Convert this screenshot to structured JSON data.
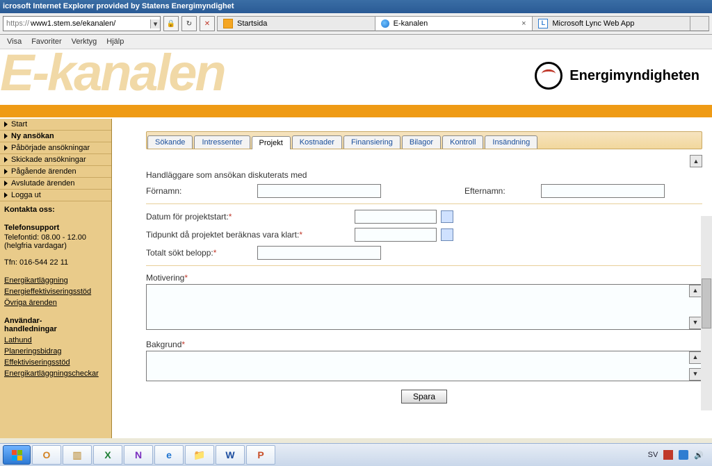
{
  "window": {
    "title": "icrosoft Internet Explorer provided by Statens Energimyndighet"
  },
  "address": {
    "protocol": "https://",
    "url": "www1.stem.se/ekanalen/"
  },
  "browser_tabs": [
    {
      "label": "Startsida",
      "icon": "fav-orange",
      "active": false
    },
    {
      "label": "E-kanalen",
      "icon": "fav-ie",
      "active": true
    },
    {
      "label": "Microsoft Lync Web App",
      "icon": "fav-lync",
      "active": false
    }
  ],
  "menubar": [
    "Visa",
    "Favoriter",
    "Verktyg",
    "Hjälp"
  ],
  "banner": {
    "logo_text": "E-kanalen",
    "brand": "Energimyndigheten"
  },
  "sidebar": {
    "nav": [
      {
        "label": "Start",
        "bold": false
      },
      {
        "label": "Ny ansökan",
        "bold": true
      },
      {
        "label": "Påbörjade ansökningar",
        "bold": false
      },
      {
        "label": "Skickade ansökningar",
        "bold": false
      },
      {
        "label": "Pågående ärenden",
        "bold": false
      },
      {
        "label": "Avslutade ärenden",
        "bold": false
      },
      {
        "label": "Logga ut",
        "bold": false
      }
    ],
    "contact_heading": "Kontakta oss:",
    "phone_heading": "Telefonsupport",
    "phone_hours": "Telefontid: 08.00 - 12.00",
    "phone_days": "(helgfria vardagar)",
    "phone_number": "Tfn: 016-544 22 11",
    "links1": [
      "Energikartläggning",
      "Energieffektiviseringsstöd",
      "Övriga ärenden"
    ],
    "guides_heading": "Användar-\nhandledningar",
    "links2": [
      "Lathund",
      "Planeringsbidrag",
      "Effektiviseringsstöd",
      "Energikartläggningscheckar"
    ]
  },
  "form_tabs": [
    "Sökande",
    "Intressenter",
    "Projekt",
    "Kostnader",
    "Finansiering",
    "Bilagor",
    "Kontroll",
    "Insändning"
  ],
  "form_active_tab": "Projekt",
  "form": {
    "handlaggare_heading": "Handläggare som ansökan diskuterats med",
    "fornamn_label": "Förnamn:",
    "efternamn_label": "Efternamn:",
    "datum_label": "Datum för projektstart:",
    "tidpunkt_label": "Tidpunkt då projektet beräknas vara klart:",
    "belopp_label": "Totalt sökt belopp:",
    "motivering_label": "Motivering",
    "bakgrund_label": "Bakgrund",
    "spara": "Spara",
    "fornamn_value": "",
    "efternamn_value": "",
    "datum_value": "",
    "tidpunkt_value": "",
    "belopp_value": ""
  },
  "tray": {
    "keyboard": "SV"
  }
}
